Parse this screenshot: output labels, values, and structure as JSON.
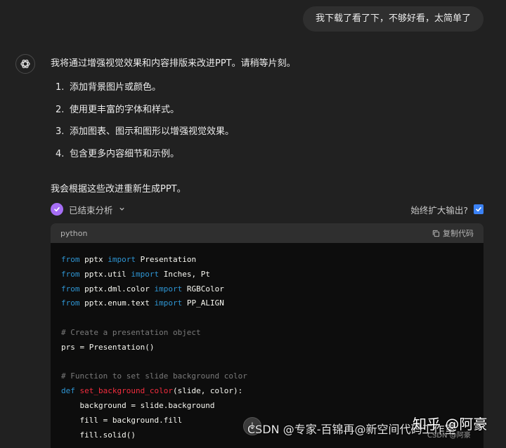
{
  "user_message": "我下载了看了下，不够好看，太简单了",
  "assistant": {
    "intro": "我将通过增强视觉效果和内容排版来改进PPT。请稍等片刻。",
    "steps": [
      {
        "num": "1.",
        "text": "添加背景图片或颜色。"
      },
      {
        "num": "2.",
        "text": "使用更丰富的字体和样式。"
      },
      {
        "num": "3.",
        "text": "添加图表、图示和图形以增强视觉效果。"
      },
      {
        "num": "4.",
        "text": "包含更多内容细节和示例。"
      }
    ],
    "outro": "我会根据这些改进重新生成PPT。"
  },
  "analysis": {
    "status": "已结束分析",
    "always_expand": "始终扩大输出?",
    "always_expand_checked": true
  },
  "code": {
    "language": "python",
    "copy_label": "复制代码",
    "lines": [
      {
        "kw": "from",
        "a": " pptx ",
        "kw2": "import",
        "b": " Presentation"
      },
      {
        "kw": "from",
        "a": " pptx.util ",
        "kw2": "import",
        "b": " Inches, Pt"
      },
      {
        "kw": "from",
        "a": " pptx.dml.color ",
        "kw2": "import",
        "b": " RGBColor"
      },
      {
        "kw": "from",
        "a": " pptx.enum.text ",
        "kw2": "import",
        "b": " PP_ALIGN"
      },
      {
        "plain": ""
      },
      {
        "comment": "# Create a presentation object"
      },
      {
        "plain": "prs = Presentation()"
      },
      {
        "plain": ""
      },
      {
        "comment": "# Function to set slide background color"
      },
      {
        "kw": "def",
        "sp": " ",
        "fn": "set_background_color",
        "b": "(slide, color):"
      },
      {
        "plain": "    background = slide.background"
      },
      {
        "plain": "    fill = background.fill"
      },
      {
        "plain": "    fill.solid()"
      }
    ]
  },
  "watermarks": {
    "csdn": "CSDN @专家-百锦再@新空间代码工作室",
    "zhihu": "知乎 @阿豪",
    "csdn_small": "CSDN @阿豪"
  },
  "colors": {
    "background": "#212121",
    "user_bubble": "#2f2f2f",
    "code_bg": "#0d0d0d",
    "keyword": "#2e95d3",
    "function": "#f22c3d",
    "comment": "#7a7a7a",
    "analysis_badge": "#a66ef5",
    "checkbox": "#3b82f6"
  }
}
